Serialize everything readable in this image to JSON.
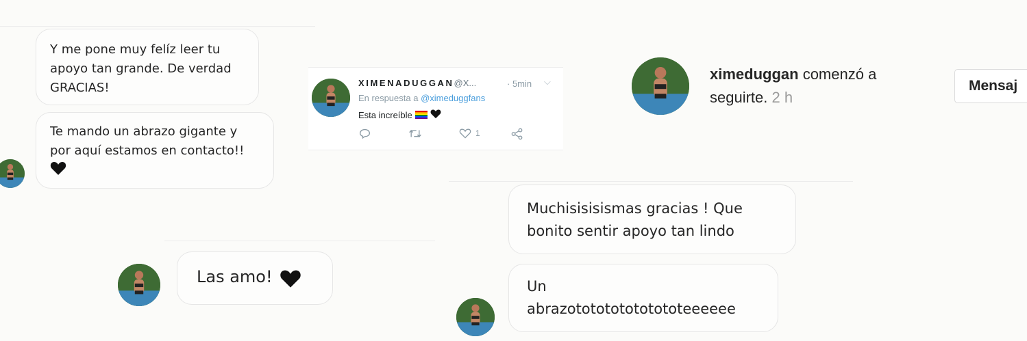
{
  "left_chat": {
    "messages": [
      {
        "text": "Y me pone muy felíz leer tu\napoyo tan grande. De verdad\nGRACIAS!"
      },
      {
        "text": "Te mando un abrazo gigante y\npor aquí estamos en contacto!!",
        "emoji": "black-heart"
      }
    ]
  },
  "bottom_left_chat": {
    "message": "Las amo!",
    "emoji": "black-heart"
  },
  "tweet": {
    "display_name": "XIMENADUGGAN",
    "handle": "@X...",
    "time": "· 5min",
    "chevron": "⌵",
    "reply_prefix": "En respuesta a ",
    "reply_mention": "@ximeduggfans",
    "body": "Esta increíble",
    "emojis": [
      "rainbow-flag",
      "black-heart"
    ],
    "likes": "1",
    "icons": [
      "reply-icon",
      "retweet-icon",
      "like-icon",
      "share-icon"
    ]
  },
  "follow_notification": {
    "username": "ximeduggan",
    "action": " comenzó a seguirte.",
    "time": " 2 h",
    "button_label": "Mensaj"
  },
  "right_chat": {
    "messages": [
      {
        "text": "Muchisisisismas gracias ! Que\nbonito sentir apoyo tan lindo"
      },
      {
        "text": "Un\nabrazototototototototeeeeee"
      }
    ]
  },
  "colors": {
    "background": "#fbfbf9",
    "bubble_border": "#e6e6e6",
    "text": "#262626",
    "twitter_mention": "#4a9edc",
    "twitter_meta": "#8a9aa4"
  }
}
